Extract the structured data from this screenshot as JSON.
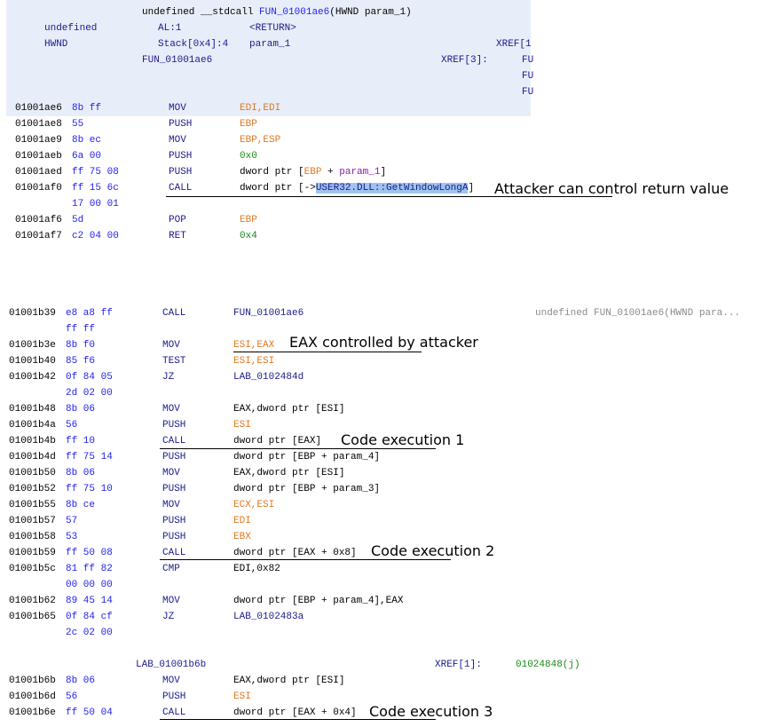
{
  "func1": {
    "signature": {
      "ret_cc": "undefined __stdcall ",
      "name": "FUN_01001ae6",
      "params": "(HWND param_1)"
    },
    "ret": {
      "type": "undefined",
      "storage": "AL:1",
      "name": "<RETURN>"
    },
    "param1": {
      "type": "HWND",
      "storage": "Stack[0x4]:4",
      "name": "param_1",
      "xref": "XREF[1"
    },
    "label": "FUN_01001ae6",
    "xref3": "XREF[3]:",
    "xref_trunc": [
      "FU",
      "FU",
      "FU"
    ],
    "lines": [
      {
        "addr": "01001ae6",
        "bytes": "8b ff",
        "mnem": "MOV",
        "ops": "EDI,EDI"
      },
      {
        "addr": "01001ae8",
        "bytes": "55",
        "mnem": "PUSH",
        "ops": "EBP"
      },
      {
        "addr": "01001ae9",
        "bytes": "8b ec",
        "mnem": "MOV",
        "ops": "EBP,ESP"
      },
      {
        "addr": "01001aeb",
        "bytes": "6a 00",
        "mnem": "PUSH",
        "ops": "0x0"
      },
      {
        "addr": "01001aed",
        "bytes": "ff 75 08",
        "mnem": "PUSH",
        "ops_a": "dword ptr [",
        "ops_b": "EBP",
        "ops_c": " + ",
        "ops_d": "param_1",
        "ops_e": "]"
      },
      {
        "addr": "01001af0",
        "bytes": "ff 15 6c",
        "bytes2": "17 00 01",
        "mnem": "CALL",
        "ops_a": "dword ptr [->",
        "ops_b": "USER32.DLL::GetWindowLongA",
        "ops_c": "]"
      },
      {
        "addr": "01001af6",
        "bytes": "5d",
        "mnem": "POP",
        "ops": "EBP"
      },
      {
        "addr": "01001af7",
        "bytes": "c2 04 00",
        "mnem": "RET",
        "ops": "0x4"
      }
    ]
  },
  "func2": {
    "call": {
      "addr": "01001b39",
      "bytes": "e8 a8 ff",
      "bytes2": "ff ff",
      "mnem": "CALL",
      "ops": "FUN_01001ae6",
      "comment": "undefined FUN_01001ae6(HWND para..."
    },
    "lines": [
      {
        "addr": "01001b3e",
        "bytes": "8b f0",
        "mnem": "MOV",
        "ops": "ESI,EAX"
      },
      {
        "addr": "01001b40",
        "bytes": "85 f6",
        "mnem": "TEST",
        "ops": "ESI,ESI"
      },
      {
        "addr": "01001b42",
        "bytes": "0f 84 05",
        "bytes2": "2d 02 00",
        "mnem": "JZ",
        "ops": "LAB_0102484d"
      },
      {
        "addr": "01001b48",
        "bytes": "8b 06",
        "mnem": "MOV",
        "ops": "EAX,dword ptr [ESI]"
      },
      {
        "addr": "01001b4a",
        "bytes": "56",
        "mnem": "PUSH",
        "ops": "ESI"
      },
      {
        "addr": "01001b4b",
        "bytes": "ff 10",
        "mnem": "CALL",
        "ops": "dword ptr [EAX]"
      },
      {
        "addr": "01001b4d",
        "bytes": "ff 75 14",
        "mnem": "PUSH",
        "ops": "dword ptr [EBP + param_4]"
      },
      {
        "addr": "01001b50",
        "bytes": "8b 06",
        "mnem": "MOV",
        "ops": "EAX,dword ptr [ESI]"
      },
      {
        "addr": "01001b52",
        "bytes": "ff 75 10",
        "mnem": "PUSH",
        "ops": "dword ptr [EBP + param_3]"
      },
      {
        "addr": "01001b55",
        "bytes": "8b ce",
        "mnem": "MOV",
        "ops": "ECX,ESI"
      },
      {
        "addr": "01001b57",
        "bytes": "57",
        "mnem": "PUSH",
        "ops": "EDI"
      },
      {
        "addr": "01001b58",
        "bytes": "53",
        "mnem": "PUSH",
        "ops": "EBX"
      },
      {
        "addr": "01001b59",
        "bytes": "ff 50 08",
        "mnem": "CALL",
        "ops": "dword ptr [EAX + 0x8]"
      },
      {
        "addr": "01001b5c",
        "bytes": "81 ff 82",
        "bytes2": "00 00 00",
        "mnem": "CMP",
        "ops": "EDI,0x82"
      },
      {
        "addr": "01001b62",
        "bytes": "89 45 14",
        "mnem": "MOV",
        "ops": "dword ptr [EBP + param_4],EAX"
      },
      {
        "addr": "01001b65",
        "bytes": "0f 84 cf",
        "bytes2": "2c 02 00",
        "mnem": "JZ",
        "ops": "LAB_0102483a"
      }
    ],
    "label2": {
      "name": "LAB_01001b6b",
      "xref": "XREF[1]:",
      "xref_target": "01024848(j)"
    },
    "lines2": [
      {
        "addr": "01001b6b",
        "bytes": "8b 06",
        "mnem": "MOV",
        "ops": "EAX,dword ptr [ESI]"
      },
      {
        "addr": "01001b6d",
        "bytes": "56",
        "mnem": "PUSH",
        "ops": "ESI"
      },
      {
        "addr": "01001b6e",
        "bytes": "ff 50 04",
        "mnem": "CALL",
        "ops": "dword ptr [EAX + 0x4]"
      }
    ]
  },
  "annotations": {
    "a1": "Attacker can control return value",
    "a2": "EAX controlled by attacker",
    "a3": "Code execution 1",
    "a4": "Code execution 2",
    "a5": "Code execution 3"
  },
  "colors": {
    "header_bg": "#e8eef9",
    "selection": "#9fc3ee",
    "bytes": "#1f1ff0",
    "register": "#e07820",
    "number": "#1a8a1a",
    "param": "#8a1aa8"
  }
}
